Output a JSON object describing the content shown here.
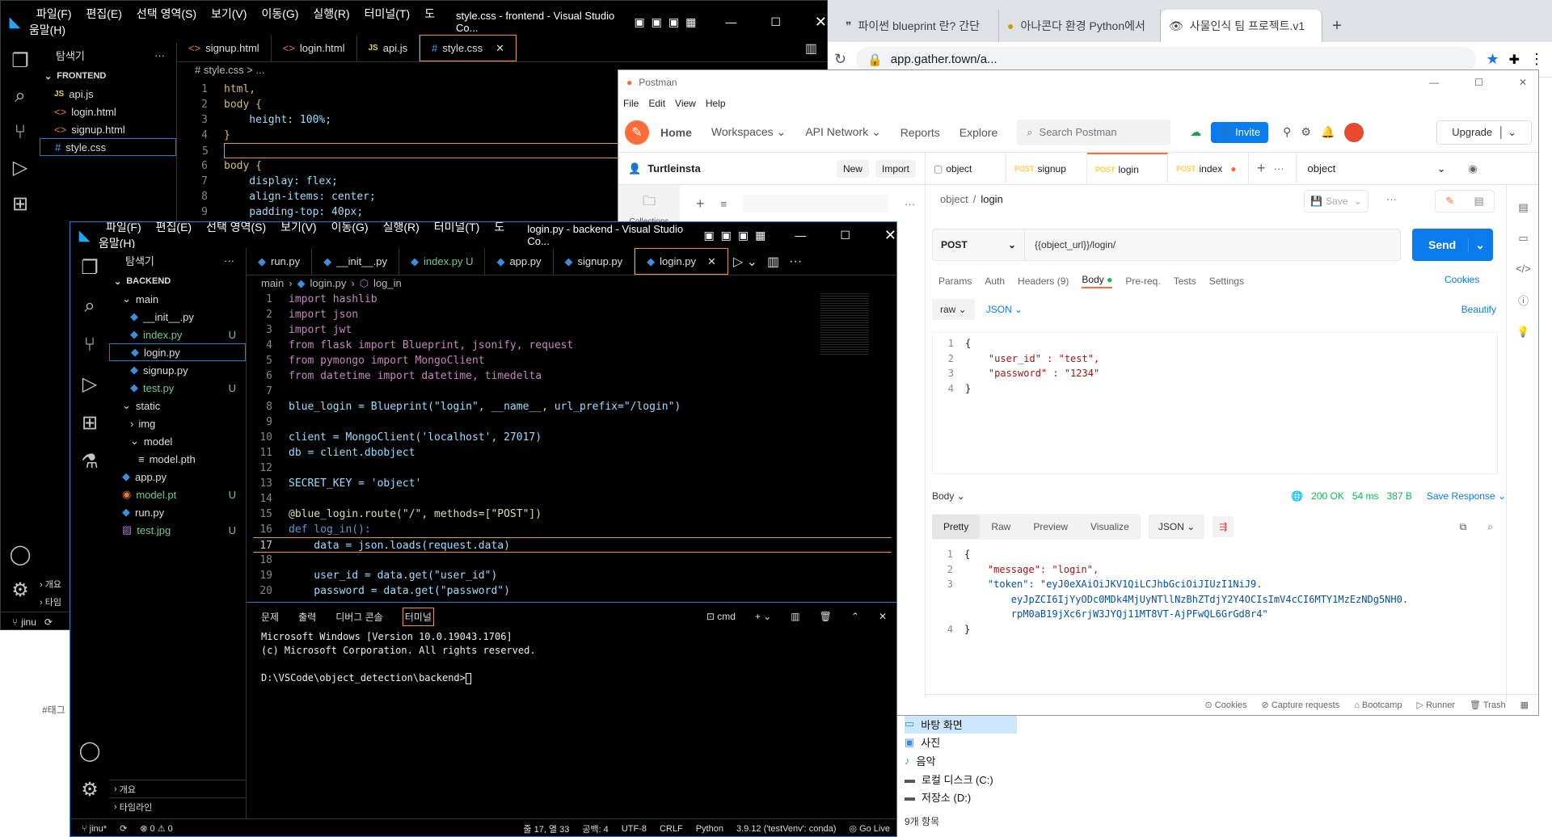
{
  "chrome": {
    "tabs": [
      "파이썬 blueprint 란? 간단",
      "아나콘다 환경 Python에서",
      "사물인식 팀 프로젝트.v1"
    ],
    "url": "app.gather.town/a..."
  },
  "vs_front": {
    "menu": [
      "파일(F)",
      "편집(E)",
      "선택 영역(S)",
      "보기(V)",
      "이동(G)",
      "실행(R)",
      "터미널(T)",
      "도움말(H)"
    ],
    "title": "style.css - frontend - Visual Studio Co...",
    "explorer_title": "탐색기",
    "folder": "FRONTEND",
    "files": [
      "api.js",
      "login.html",
      "signup.html",
      "style.css"
    ],
    "tabs": [
      "signup.html",
      "login.html",
      "api.js",
      "style.css"
    ],
    "breadcrumb": "# style.css > ...",
    "code": [
      "html,",
      "body {",
      "    height: 100%;",
      "}",
      "",
      "body {",
      "    display: flex;",
      "    align-items: center;",
      "    padding-top: 40px;"
    ],
    "outline": "개요",
    "timeline": "타임",
    "status_branch": "jinu"
  },
  "vs_back": {
    "title": "login.py - backend - Visual Studio Co...",
    "explorer_title": "탐색기",
    "folder": "BACKEND",
    "tree": [
      {
        "label": "main",
        "indent": 1,
        "type": "folder"
      },
      {
        "label": "__init__.py",
        "indent": 2,
        "type": "py",
        "badge": ""
      },
      {
        "label": "index.py",
        "indent": 2,
        "type": "py",
        "badge": "U"
      },
      {
        "label": "login.py",
        "indent": 2,
        "type": "py",
        "badge": ""
      },
      {
        "label": "signup.py",
        "indent": 2,
        "type": "py",
        "badge": ""
      },
      {
        "label": "test.py",
        "indent": 2,
        "type": "py",
        "badge": "U"
      },
      {
        "label": "static",
        "indent": 1,
        "type": "folder"
      },
      {
        "label": "img",
        "indent": 2,
        "type": "folder-closed"
      },
      {
        "label": "model",
        "indent": 2,
        "type": "folder"
      },
      {
        "label": "model.pth",
        "indent": 3,
        "type": "file",
        "badge": ""
      },
      {
        "label": "app.py",
        "indent": 1,
        "type": "py",
        "badge": ""
      },
      {
        "label": "model.pt",
        "indent": 1,
        "type": "rss",
        "badge": "U"
      },
      {
        "label": "run.py",
        "indent": 1,
        "type": "py",
        "badge": ""
      },
      {
        "label": "test.jpg",
        "indent": 1,
        "type": "img",
        "badge": "U"
      }
    ],
    "tabs": [
      "run.py",
      "__init__.py",
      "index.py U",
      "app.py",
      "signup.py",
      "login.py"
    ],
    "breadcrumb": [
      "main",
      "login.py",
      "log_in"
    ],
    "code": [
      "import hashlib",
      "import json",
      "import jwt",
      "from flask import Blueprint, jsonify, request",
      "from pymongo import MongoClient",
      "from datetime import datetime, timedelta",
      "",
      "blue_login = Blueprint(\"login\", __name__, url_prefix=\"/login\")",
      "",
      "client = MongoClient('localhost', 27017)",
      "db = client.dbobject",
      "",
      "SECRET_KEY = 'object'",
      "",
      "@blue_login.route(\"/\", methods=[\"POST\"])",
      "def log_in():",
      "    data = json.loads(request.data)",
      "",
      "    user_id = data.get(\"user_id\")",
      "    password = data.get(\"password\")"
    ],
    "panel_tabs": [
      "문제",
      "출력",
      "디버그 콘솔",
      "터미널"
    ],
    "terminal_name": "cmd",
    "terminal": [
      "Microsoft Windows [Version 10.0.19043.1706]",
      "(c) Microsoft Corporation. All rights reserved.",
      "",
      "D:\\VSCode\\object_detection\\backend>"
    ],
    "outline": "개요",
    "timeline": "타임라인",
    "status": {
      "branch": "jinu*",
      "errors": "⊗ 0 ⚠ 0",
      "pos": "줄 17, 열 33",
      "spaces": "공백: 4",
      "enc": "UTF-8",
      "eol": "CRLF",
      "lang": "Python",
      "interp": "3.9.12 ('testVenv': conda)",
      "live": "Go Live"
    }
  },
  "postman": {
    "title": "Postman",
    "menu": [
      "File",
      "Edit",
      "View",
      "Help"
    ],
    "nav": [
      "Home",
      "Workspaces",
      "API Network",
      "Reports",
      "Explore"
    ],
    "search": "Search Postman",
    "invite": "Invite",
    "upgrade": "Upgrade",
    "workspace": "Turtleinsta",
    "new_btn": "New",
    "import_btn": "Import",
    "collections": "Collections",
    "req_tabs": [
      {
        "method": "",
        "name": "object"
      },
      {
        "method": "POST",
        "name": "signup"
      },
      {
        "method": "POST",
        "name": "login"
      },
      {
        "method": "POST",
        "name": "index"
      }
    ],
    "env": "object",
    "breadcrumb": [
      "object",
      "login"
    ],
    "save": "Save",
    "method": "POST",
    "url": "{{object_url}}/login/",
    "send": "Send",
    "req_subtabs": [
      "Params",
      "Auth",
      "Headers (9)",
      "Body",
      "Pre-req.",
      "Tests",
      "Settings"
    ],
    "cookies": "Cookies",
    "body_mode": "raw",
    "body_lang": "JSON",
    "beautify": "Beautify",
    "req_body": [
      "{",
      "    \"user_id\" : \"test\",",
      "    \"password\" : \"1234\"",
      "}"
    ],
    "resp_label": "Body",
    "status": "200 OK",
    "time": "54 ms",
    "size": "387 B",
    "save_response": "Save Response",
    "resp_tabs": [
      "Pretty",
      "Raw",
      "Preview",
      "Visualize"
    ],
    "resp_lang": "JSON",
    "resp_body": [
      "{",
      "    \"message\": \"login\",",
      "    \"token\": \"eyJ0eXAiOiJKV1QiLCJhbGciOiJIUzI1NiJ9.",
      "        eyJpZCI6IjYyODc0MDk4MjUyNTllNzBhZTdjY2Y4OCIsImV4cCI6MTY1MzEzNDg5NH0.",
      "        rpM0aB19jXc6rjW3JYQj11MT8VT-AjPFwQL6GrGd8r4\"",
      "}"
    ],
    "resp_line_nums": [
      "1",
      "2",
      "3",
      "",
      "",
      "4"
    ],
    "footer": [
      "Cookies",
      "Capture requests",
      "Bootcamp",
      "Runner",
      "Trash"
    ]
  },
  "explorer_win": {
    "items": [
      "바탕 화면",
      "사진",
      "음악",
      "로컬 디스크 (C:)",
      "저장소 (D:)"
    ],
    "count": "9개 항목"
  },
  "hashtag": "#태그"
}
